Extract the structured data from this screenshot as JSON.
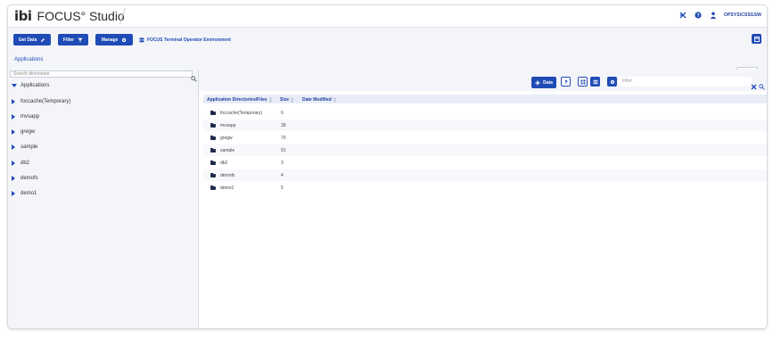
{
  "app": {
    "logo": "ibi",
    "title": "FOCUS° Studio",
    "user": "OPSYS\\CSSGSW"
  },
  "toolbar": {
    "get_data_label": "Get Data",
    "filter_label": "Filter",
    "manage_label": "Manage",
    "environment_label": "FOCUS Terminal Operator Environment"
  },
  "breadcrumb": {
    "current": "Applications"
  },
  "left_panel": {
    "search_placeholder": "Search directories",
    "root_label": "Applications",
    "items": [
      {
        "label": "foccache(Temporary)"
      },
      {
        "label": "mvsapp"
      },
      {
        "label": "gregw"
      },
      {
        "label": "sample"
      },
      {
        "label": "db2"
      },
      {
        "label": "demofs"
      },
      {
        "label": "demo1"
      }
    ]
  },
  "right_panel": {
    "data_button_label": "Data",
    "filter_placeholder": "Filter",
    "columns": [
      {
        "label": "Application Directories/Files"
      },
      {
        "label": "Size"
      },
      {
        "label": "Date Modified"
      }
    ],
    "rows": [
      {
        "name": "foccache(Temporary)",
        "size": "0"
      },
      {
        "name": "mvsapp",
        "size": "39"
      },
      {
        "name": "gregw",
        "size": "70"
      },
      {
        "name": "sample",
        "size": "91"
      },
      {
        "name": "db2",
        "size": "3"
      },
      {
        "name": "demofs",
        "size": "4"
      },
      {
        "name": "demo1",
        "size": "5"
      }
    ]
  },
  "colors": {
    "accent": "#1f4bb6",
    "background": "#f4f5f9",
    "close_red": "#1f4bb6"
  }
}
